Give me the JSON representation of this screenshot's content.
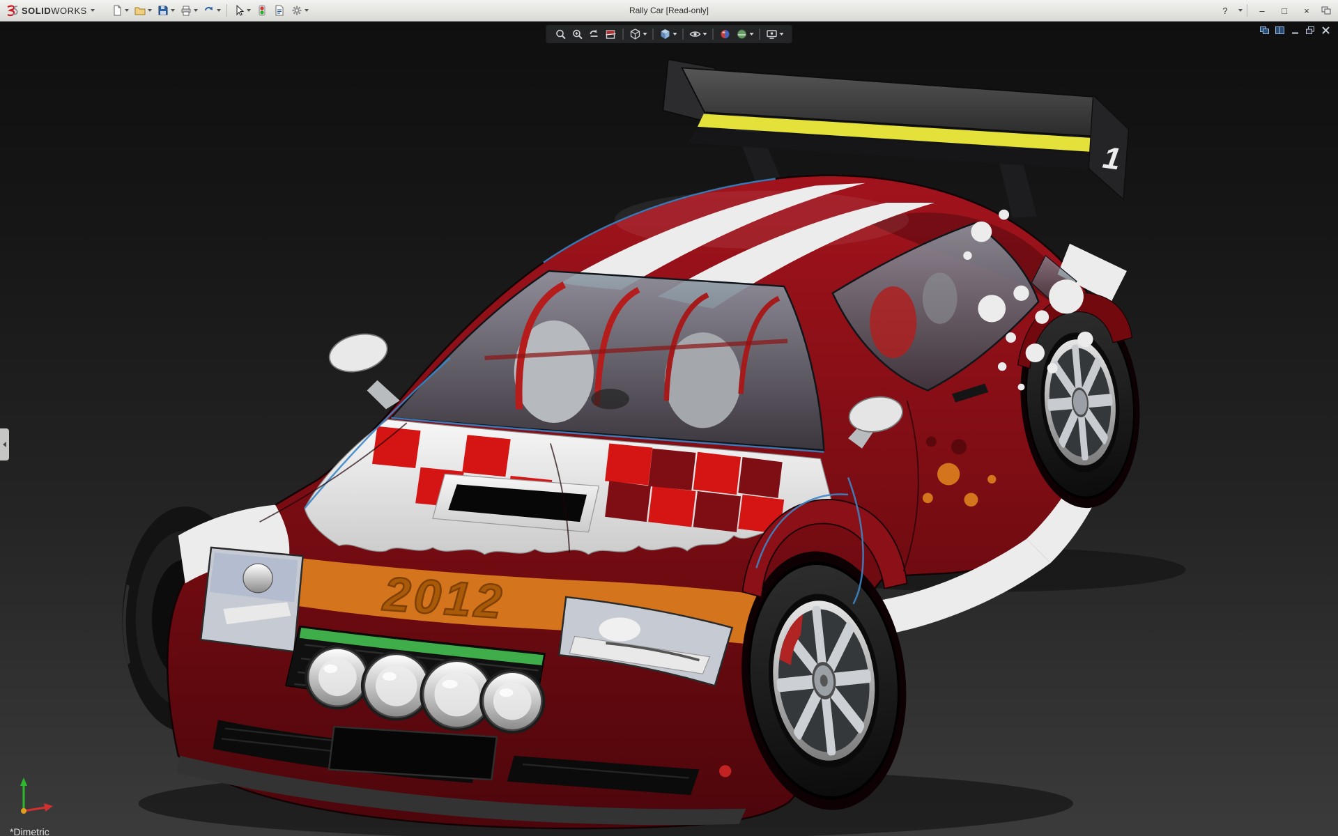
{
  "colors": {
    "body_red": "#7e0d14",
    "checker_red": "#d51414",
    "accent_orange": "#d4741d",
    "decal_orange": "#a85a08",
    "stripe_white": "#ececec",
    "wing_yellow": "#e3e13a",
    "grille_green": "#3fae4a",
    "edge_blue": "#3c86c8"
  },
  "window": {
    "brand_bold": "SOLID",
    "brand_light": "WORKS",
    "title": "Rally Car [Read-only]",
    "controls": {
      "help": "?",
      "minimize": "–",
      "maximize": "□",
      "close": "×"
    }
  },
  "main_toolbar": {
    "items": [
      "new-document",
      "open",
      "save",
      "print",
      "undo",
      "select",
      "rebuild",
      "file-properties",
      "options"
    ]
  },
  "heads_up_toolbar": {
    "items": [
      "zoom-to-fit",
      "zoom-to-area",
      "previous-view",
      "section-view",
      "view-orientation",
      "display-style",
      "hide-show-items",
      "edit-appearance",
      "apply-scene",
      "view-settings"
    ]
  },
  "document_controls": {
    "items": [
      "cascade-document",
      "tile-document",
      "minimize-document",
      "restore-document",
      "close-document"
    ]
  },
  "viewport": {
    "orientation_label": "*Dimetric",
    "decals": {
      "hood_year": "2012",
      "wing_number": "1"
    }
  }
}
